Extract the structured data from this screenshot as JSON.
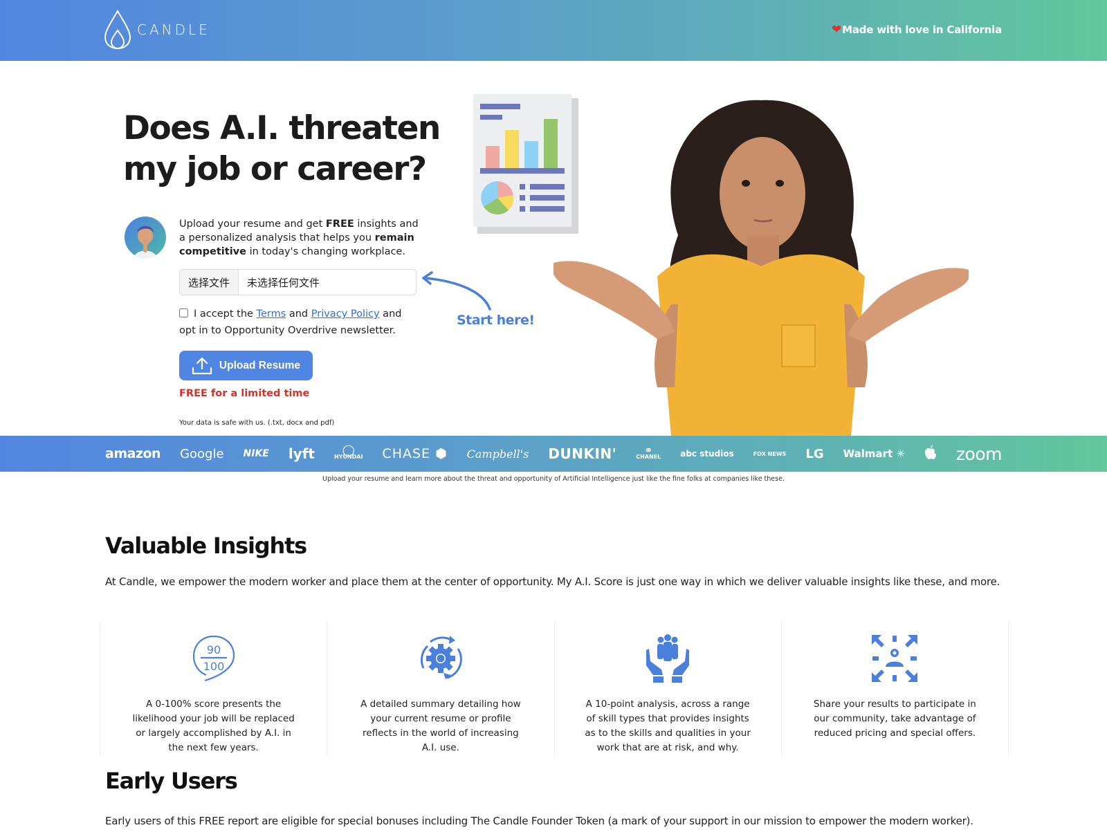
{
  "header": {
    "logo_text": "CANDLE",
    "tagline_icon": "heart-icon",
    "tagline": "Made with love in California"
  },
  "hero": {
    "title": "Does A.I. threaten my job or career?",
    "intro": {
      "part1": "Upload your resume and get ",
      "bold1": "FREE",
      "part2": " insights and a personalized analysis that helps you ",
      "bold2": "remain competitive",
      "part3": " in today's changing workplace."
    },
    "file_input": {
      "button_label": "选择文件",
      "status": "未选择任何文件"
    },
    "consent": {
      "checked": false,
      "part1": "I accept the ",
      "terms_link": "Terms",
      "part2": " and ",
      "privacy_link": "Privacy Policy",
      "part3": " and opt in to Opportunity Overdrive newsletter."
    },
    "upload_button": "Upload Resume",
    "upload_icon": "upload-icon",
    "free_note": "FREE for a limited time",
    "safe_note": "Your data is safe with us. (.txt, docx and pdf)",
    "start_here": "Start here!"
  },
  "brands": {
    "items": [
      "amazon",
      "Google",
      "NIKE",
      "lyft",
      "HYUNDAI",
      "CHASE",
      "Campbell's",
      "DUNKIN'",
      "CHANEL",
      "abc studios",
      "FOX NEWS",
      "LG",
      "Walmart",
      "Apple",
      "zoom"
    ],
    "caption": "Upload your resume and learn more about the threat and opportunity of Artificial Intelligence just like the fine folks at companies like these."
  },
  "insights": {
    "title": "Valuable Insights",
    "description": "At Candle, we empower the modern worker and place them at the center of opportunity. My A.I. Score is just one way in which we deliver valuable insights like these, and more.",
    "features": [
      {
        "icon": "score-90-100-icon",
        "score_top": "90",
        "score_bottom": "100",
        "text": "A 0-100% score presents the likelihood your job will be replaced or largely accomplished by A.I. in the next few years."
      },
      {
        "icon": "gear-cycle-icon",
        "text": "A detailed summary detailing how your current resume or profile reflects in the world of increasing A.I. use."
      },
      {
        "icon": "hands-people-icon",
        "text": "A 10-point analysis, across a range of skill types that provides insights as to the skills and qualities in your work that are at risk, and why."
      },
      {
        "icon": "share-expand-user-icon",
        "text": "Share your results to participate in our community, take advantage of reduced pricing and special offers."
      }
    ]
  },
  "early_users": {
    "title": "Early Users",
    "description": "Early users of this FREE report are eligible for special bonuses including The Candle Founder Token (a mark of your support in our mission to empower the modern worker)."
  },
  "colors": {
    "accent_blue": "#4f86e3",
    "gradient_start": "#5285e0",
    "gradient_end": "#62c79c",
    "free_red": "#d3322a",
    "link_blue": "#2f6fd8"
  }
}
